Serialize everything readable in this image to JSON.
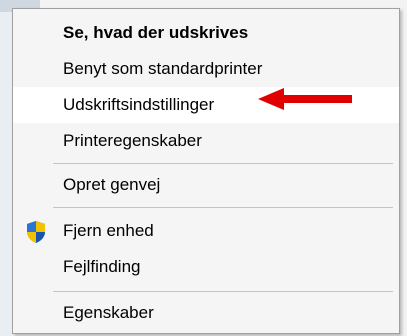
{
  "context_menu": {
    "items": [
      {
        "label": "Se, hvad der udskrives",
        "bold": true
      },
      {
        "label": "Benyt som standardprinter"
      },
      {
        "label": "Udskriftsindstillinger",
        "highlighted": true
      },
      {
        "label": "Printeregenskaber"
      },
      {
        "label": "Opret genvej"
      },
      {
        "label": "Fjern enhed",
        "icon": "uac-shield-icon"
      },
      {
        "label": "Fejlfinding"
      },
      {
        "label": "Egenskaber"
      }
    ]
  },
  "annotation": {
    "arrow_color": "#e00000",
    "points_to": "Udskriftsindstillinger"
  },
  "colors": {
    "menu_background": "#f5f5f5",
    "separator": "#c4c4c4",
    "shield_blue": "#1f5fbf",
    "shield_yellow": "#f2c200"
  }
}
